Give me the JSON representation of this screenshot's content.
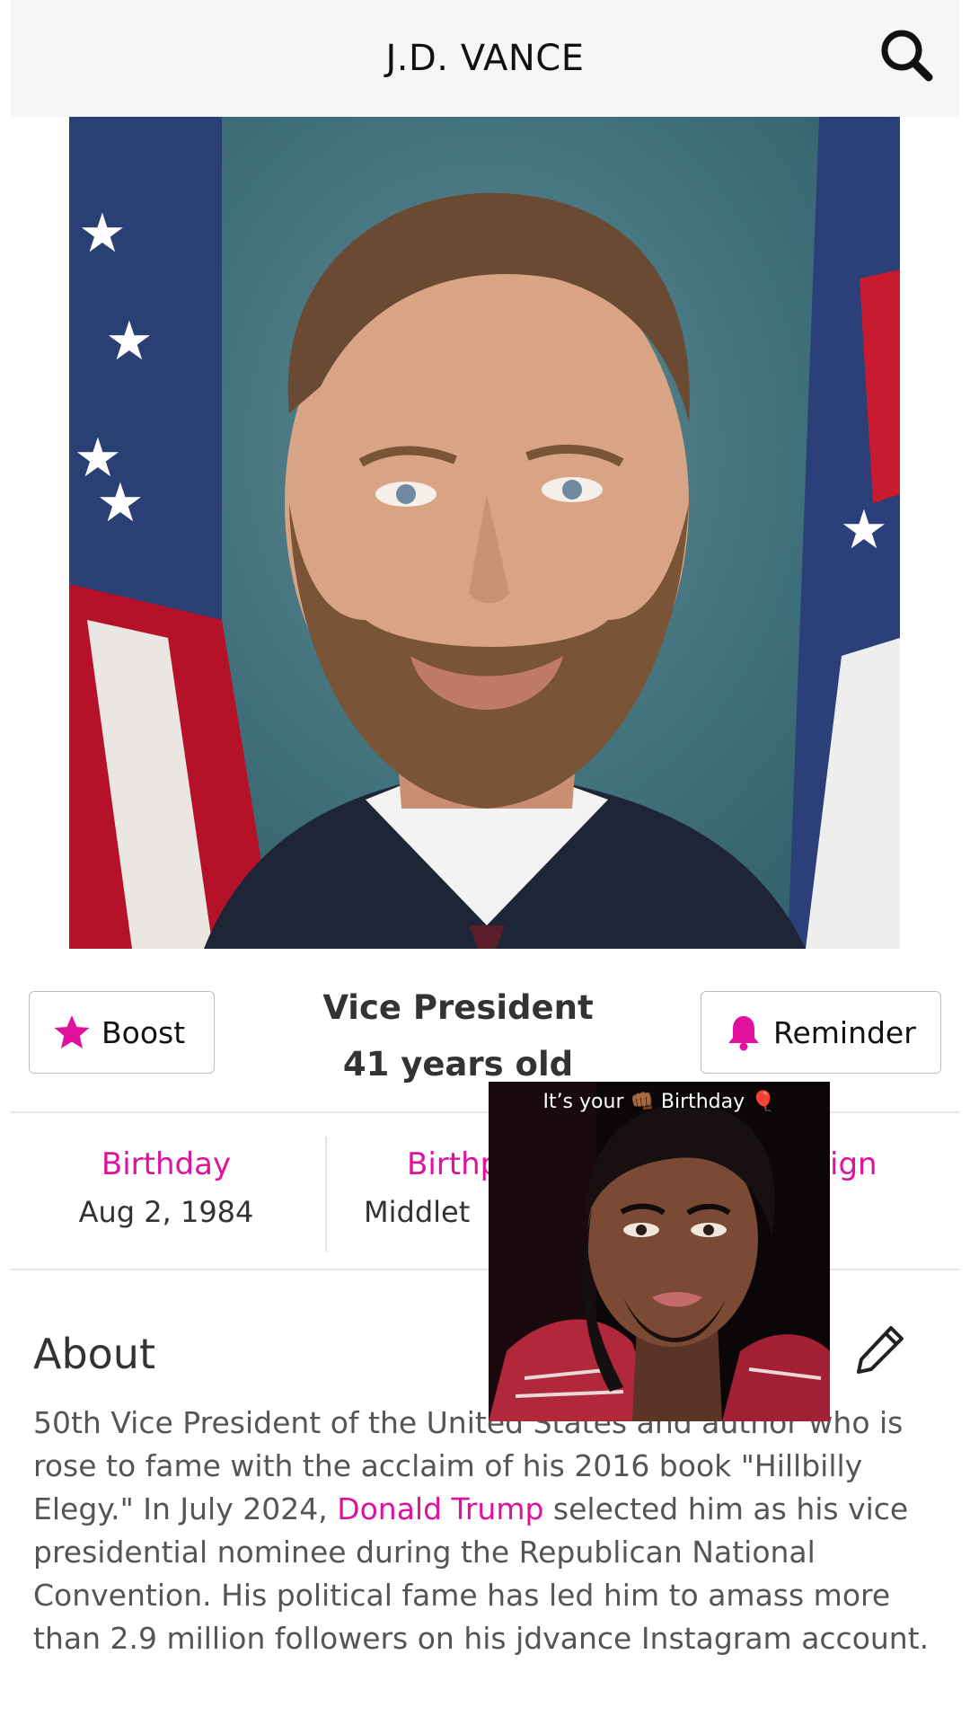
{
  "header": {
    "title": "J.D. VANCE",
    "search_icon": "search-icon"
  },
  "photo": {
    "share_icon": "share-icon"
  },
  "actions": {
    "boost_label": "Boost",
    "reminder_label": "Reminder"
  },
  "profile": {
    "role": "Vice President",
    "age": "41 years old"
  },
  "facts": [
    {
      "label": "Birthday",
      "value": "Aug 2, 1984"
    },
    {
      "label": "Birthp",
      "value": "Middlet"
    },
    {
      "label": "ign",
      "value": ""
    }
  ],
  "about": {
    "heading": "About",
    "text_before_link": "50th Vice President of the United States and author who is rose to fame with the acclaim of his 2016 book \"Hillbilly Elegy.\" In July 2024, ",
    "link_text": "Donald Trump",
    "text_after_link": " selected him as his vice presidential nominee during the Republican National Convention. His political fame has led him to amass more than 2.9 million followers on his jdvance Instagram account."
  },
  "overlay": {
    "caption": "It’s your 👊🏾 Birthday 🎈"
  },
  "colors": {
    "accent": "#e0119d",
    "text": "#333333",
    "header_bg": "#f6f6f6"
  }
}
